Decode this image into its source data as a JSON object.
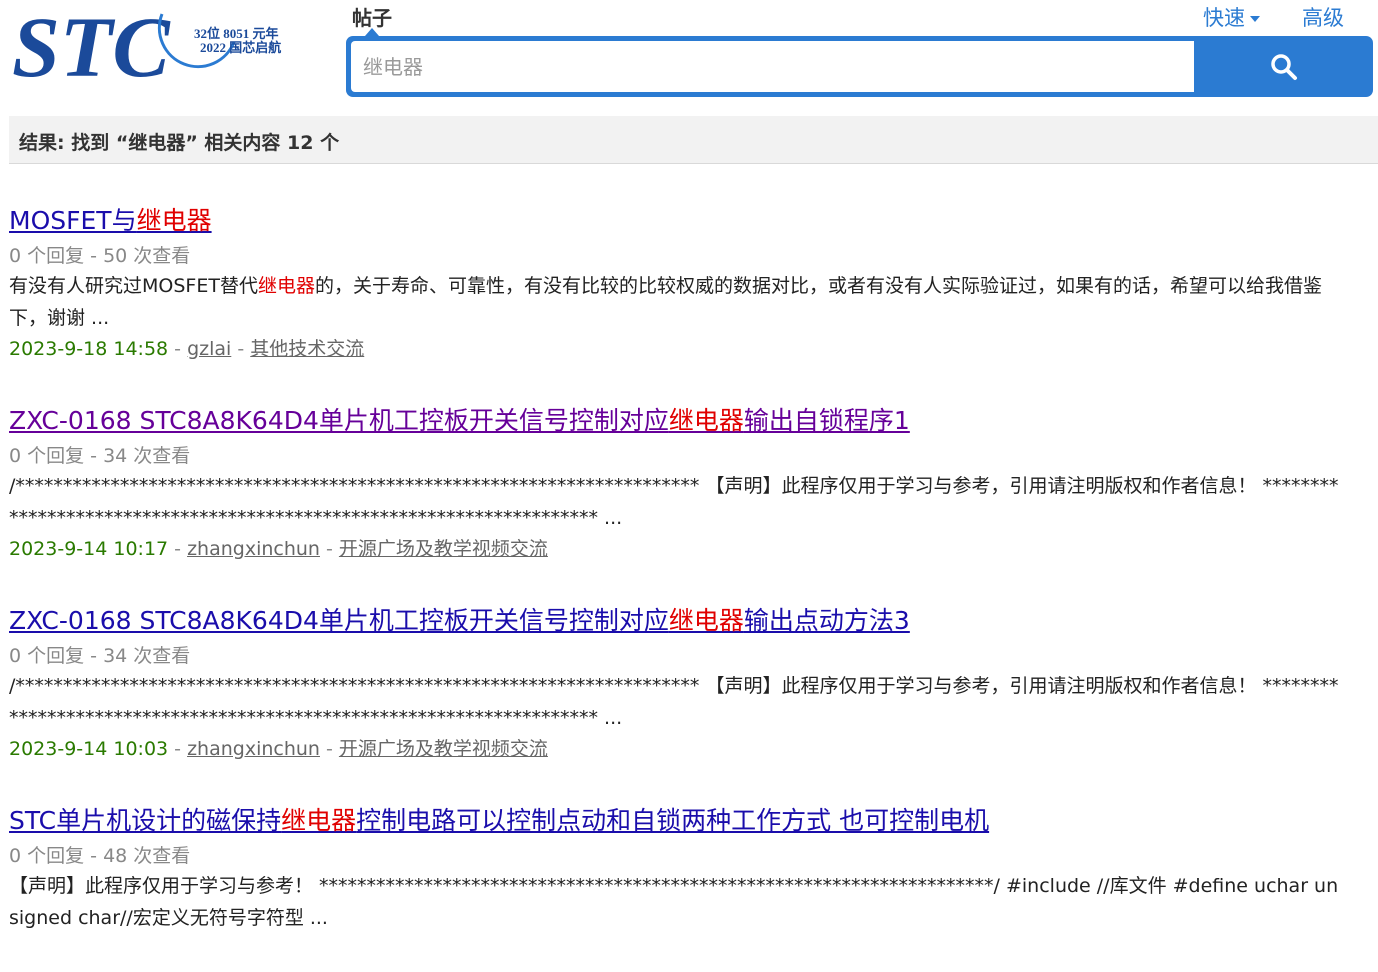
{
  "logo": {
    "main_text": "STC",
    "line1": "32位 8051 元年",
    "line2": "2022 国芯启航"
  },
  "header": {
    "tab_label": "帖子",
    "quick_link": "快速",
    "advanced_link": "高级"
  },
  "search": {
    "placeholder": "继电器"
  },
  "summary": {
    "text": "结果: 找到 “继电器” 相关内容 12 个"
  },
  "results": [
    {
      "title_pre": "MOSFET与",
      "title_hl": "继电器",
      "title_post": "",
      "visited": false,
      "stats": "0 个回复 - 50 次查看",
      "snippet_pre": "有没有人研究过MOSFET替代",
      "snippet_hl": "继电器",
      "snippet_post": "的，关于寿命、可靠性，有没有比较的比较权威的数据对比，或者有没有人实际验证过，如果有的话，希望可以给我借鉴下，谢谢 ...",
      "date": "2023-9-18 14:58",
      "author": "gzlai",
      "forum": "其他技术交流"
    },
    {
      "title_pre": "ZXC-0168 STC8A8K64D4单片机工控板开关信号控制对应",
      "title_hl": "继电器",
      "title_post": "输出自锁程序1",
      "visited": true,
      "stats": "0 个回复 - 34 次查看",
      "snippet_pre": "/************************************************************************ 【声明】此程序仅用于学习与参考，引用请注明版权和作者信息！ ********************************************************************** ...",
      "snippet_hl": "",
      "snippet_post": "",
      "date": "2023-9-14 10:17",
      "author": "zhangxinchun",
      "forum": "开源广场及教学视频交流"
    },
    {
      "title_pre": "ZXC-0168 STC8A8K64D4单片机工控板开关信号控制对应",
      "title_hl": "继电器",
      "title_post": "输出点动方法3",
      "visited": false,
      "stats": "0 个回复 - 34 次查看",
      "snippet_pre": "/************************************************************************ 【声明】此程序仅用于学习与参考，引用请注明版权和作者信息！ ********************************************************************** ...",
      "snippet_hl": "",
      "snippet_post": "",
      "date": "2023-9-14 10:03",
      "author": "zhangxinchun",
      "forum": "开源广场及教学视频交流"
    },
    {
      "title_pre": "STC单片机设计的磁保持",
      "title_hl": "继电器",
      "title_post": "控制电路可以控制点动和自锁两种工作方式 也可控制电机",
      "visited": false,
      "stats": "0 个回复 - 48 次查看",
      "snippet_pre": "【声明】此程序仅用于学习与参考！ ***********************************************************************/ #include //库文件 #define uchar unsigned char//宏定义无符号字符型 ...",
      "snippet_hl": "",
      "snippet_post": "",
      "date": "",
      "author": "",
      "forum": ""
    }
  ],
  "colors": {
    "accent": "#2b7bd2",
    "link": "#1a0dab",
    "visited": "#660099",
    "highlight": "#e00000",
    "date": "#2a7a00"
  }
}
